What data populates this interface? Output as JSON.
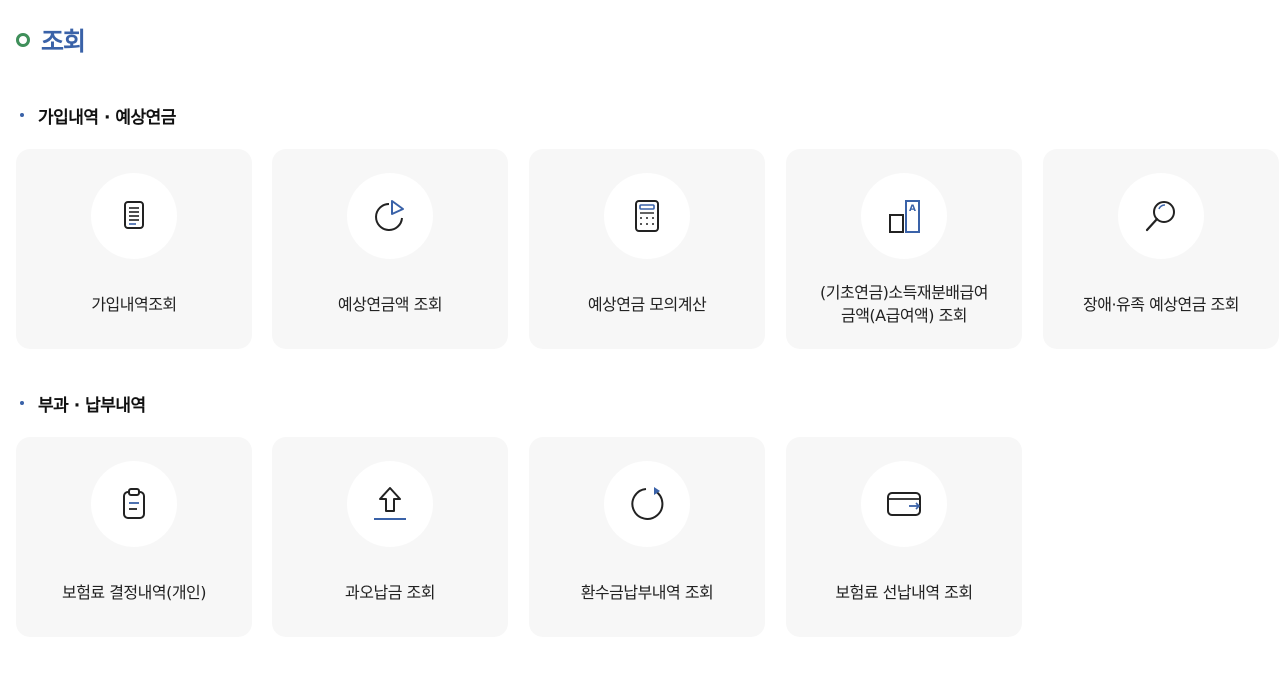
{
  "page": {
    "title": "조회"
  },
  "sections": [
    {
      "title": "가입내역 · 예상연금",
      "cards": [
        {
          "label": "가입내역조회",
          "icon": "document-list-icon"
        },
        {
          "label": "예상연금액 조회",
          "icon": "pie-chart-icon"
        },
        {
          "label": "예상연금 모의계산",
          "icon": "calculator-icon"
        },
        {
          "label": "(기초연금)소득재분배급여\n금액(A급여액) 조회",
          "icon": "bar-a-icon"
        },
        {
          "label": "장애·유족 예상연금 조회",
          "icon": "magnifier-icon"
        }
      ]
    },
    {
      "title": "부과 · 납부내역",
      "cards": [
        {
          "label": "보험료 결정내역(개인)",
          "icon": "clipboard-icon"
        },
        {
          "label": "과오납금 조회",
          "icon": "upload-arrow-icon"
        },
        {
          "label": "환수금납부내역 조회",
          "icon": "refresh-icon"
        },
        {
          "label": "보험료 선납내역 조회",
          "icon": "wallet-icon"
        }
      ]
    }
  ],
  "colors": {
    "accent": "#3a62a8",
    "title_ring": "#3f8f5a",
    "card_bg": "#f7f7f7",
    "icon_stroke": "#222222"
  }
}
